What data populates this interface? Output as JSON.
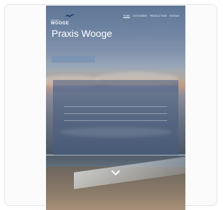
{
  "site": {
    "logo_small": "PRAXIS",
    "logo_big": "WOOGE",
    "nav": [
      "HOME",
      "LEISTUNGEN",
      "PRAXIS & TEAM",
      "KONTAKT"
    ],
    "title": "Praxis Wooge",
    "subtitle": "",
    "cta_label": "",
    "hours": {
      "heading": "",
      "rows": [
        {
          "day": "",
          "time": ""
        },
        {
          "day": "",
          "time": ""
        },
        {
          "day": "",
          "time": ""
        }
      ],
      "note": "",
      "phone": ""
    }
  },
  "colors": {
    "panel": "#465c82",
    "cta": "#7d95b4",
    "card_border": "#e3e3e3"
  },
  "icons": {
    "logo": "bird-icon",
    "scroll": "chevron-down-icon",
    "panel": "clock-icon"
  }
}
